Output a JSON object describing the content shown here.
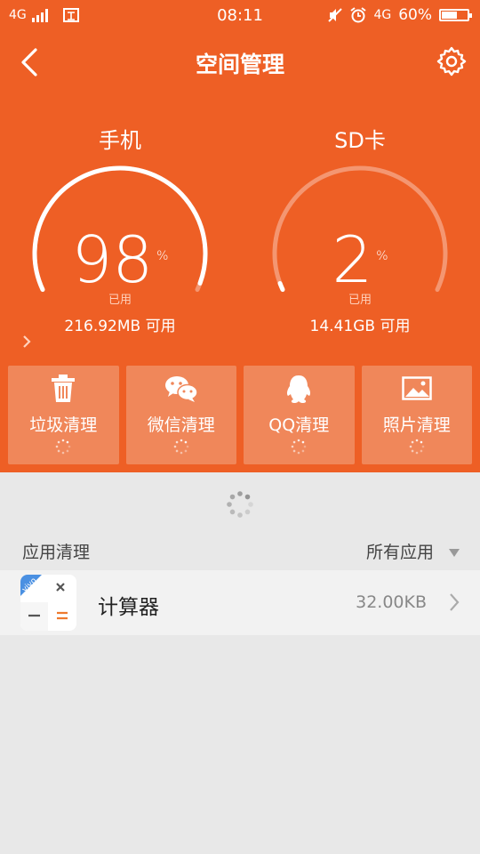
{
  "colors": {
    "accent": "#ee5f25",
    "tile": "#f0875a",
    "background": "#e8e8e8"
  },
  "status_bar": {
    "network_left": "4G",
    "time": "08:11",
    "network_right": "4G",
    "battery_pct": "60%",
    "battery_level": 0.6,
    "icons": [
      "signal-icon",
      "storage-icon",
      "mute-icon",
      "alarm-icon",
      "battery-icon"
    ]
  },
  "nav": {
    "title": "空间管理",
    "icons": [
      "back-icon",
      "settings-gear-icon"
    ]
  },
  "gauges": [
    {
      "label": "手机",
      "percent": "98",
      "percent_value": 98,
      "unit": "%",
      "used_label": "已用",
      "available": "216.92MB 可用",
      "has_arrow": true
    },
    {
      "label": "SD卡",
      "percent": "2",
      "percent_value": 2,
      "unit": "%",
      "used_label": "已用",
      "available": "14.41GB 可用",
      "has_arrow": false
    }
  ],
  "tiles": [
    {
      "label": "垃圾清理",
      "icon": "trash-icon"
    },
    {
      "label": "微信清理",
      "icon": "wechat-icon"
    },
    {
      "label": "QQ清理",
      "icon": "qq-icon"
    },
    {
      "label": "照片清理",
      "icon": "photo-icon"
    }
  ],
  "section": {
    "title": "应用清理",
    "filter": "所有应用"
  },
  "apps": [
    {
      "name": "计算器",
      "size": "32.00KB",
      "badge": "vivo",
      "icon": "calculator-icon"
    }
  ]
}
